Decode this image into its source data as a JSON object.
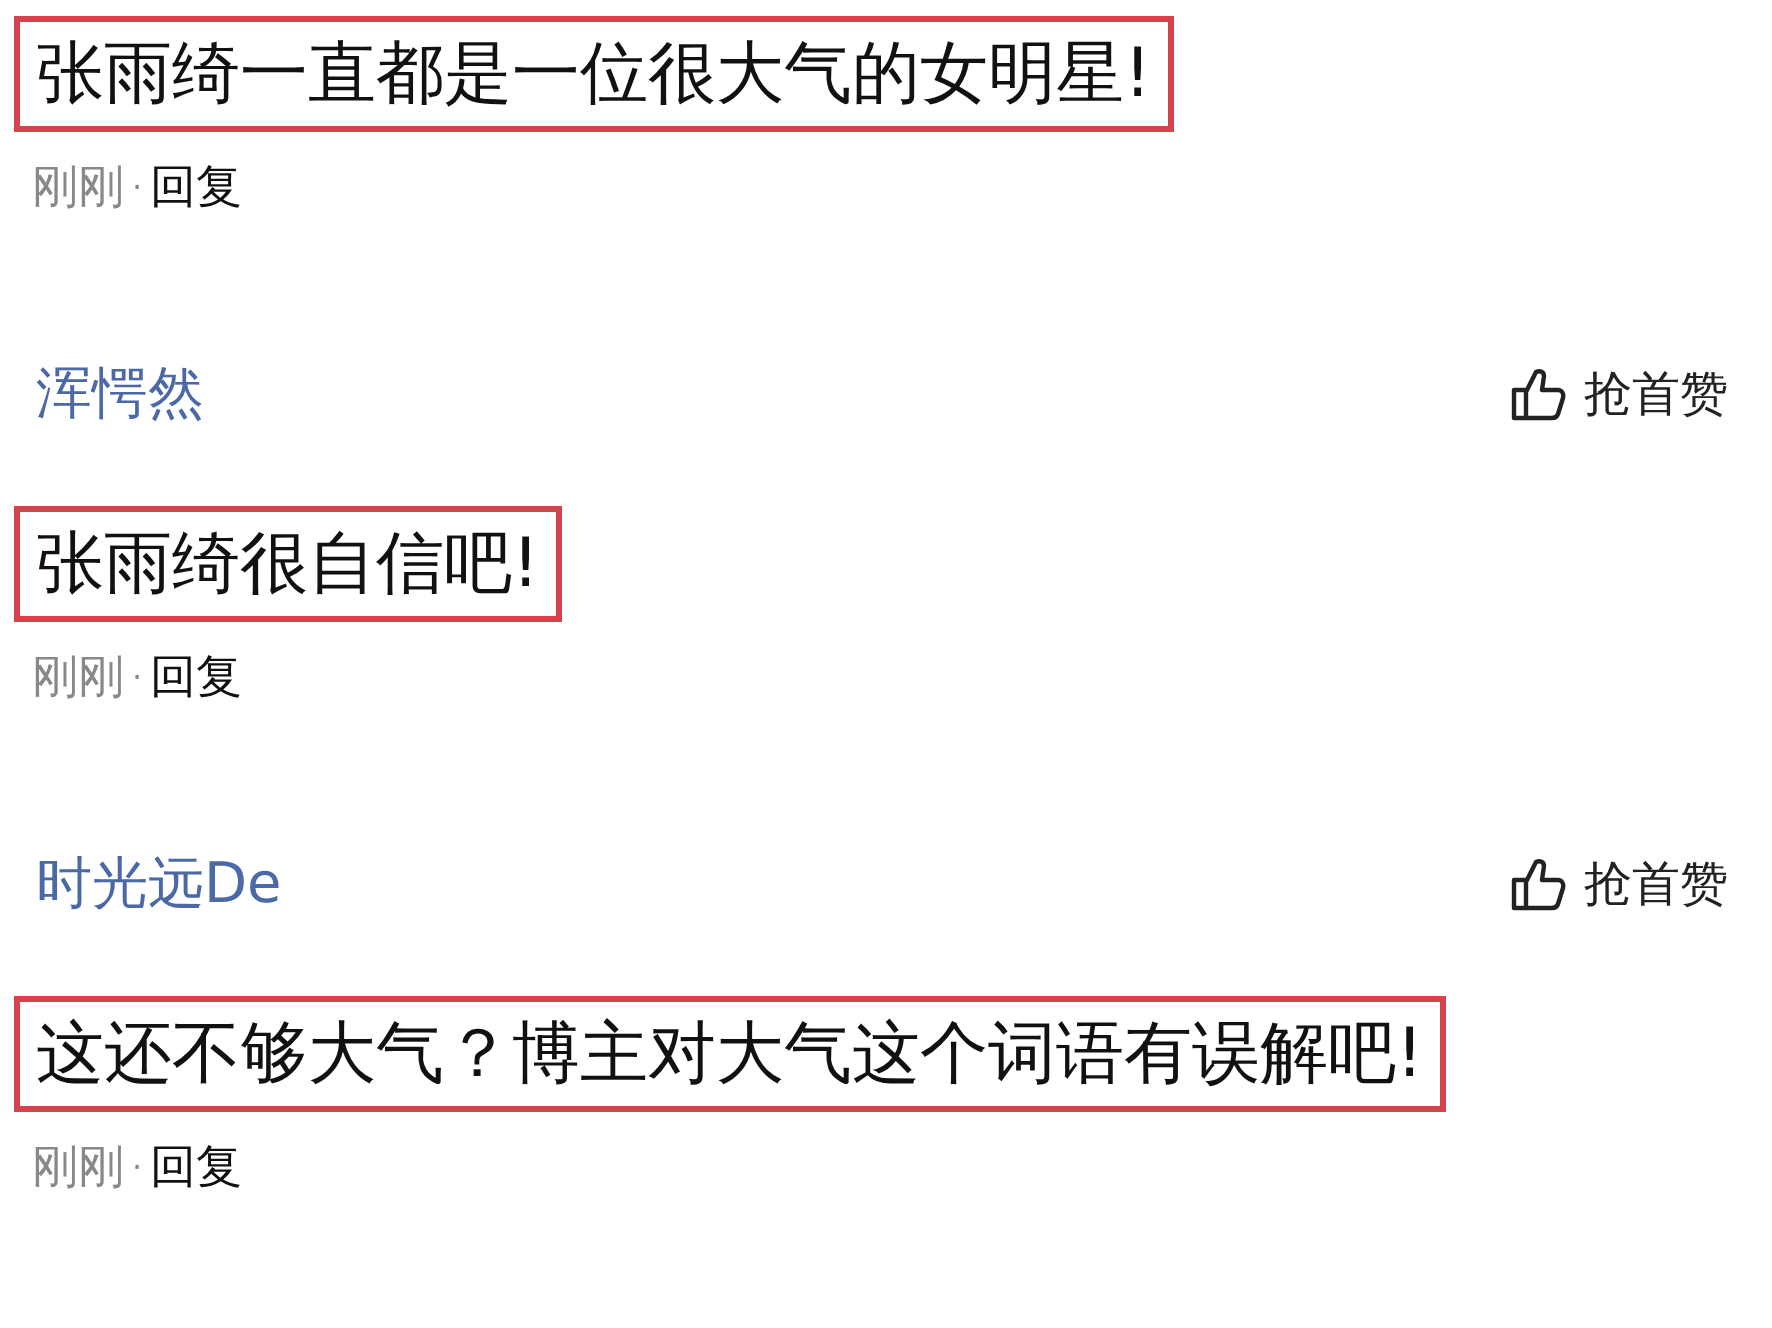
{
  "comments": [
    {
      "text": "张雨绮一直都是一位很大气的女明星!",
      "highlighted": true,
      "time": "刚刚",
      "separator": "·",
      "reply": "回复"
    },
    {
      "user": "浑愕然",
      "like": "抢首赞",
      "text": "张雨绮很自信吧!",
      "highlighted": true,
      "time": "刚刚",
      "separator": "·",
      "reply": "回复"
    },
    {
      "user": "时光远De",
      "like": "抢首赞",
      "text": "这还不够大气？博主对大气这个词语有误解吧!",
      "highlighted": true,
      "time": "刚刚",
      "separator": "·",
      "reply": "回复"
    }
  ]
}
